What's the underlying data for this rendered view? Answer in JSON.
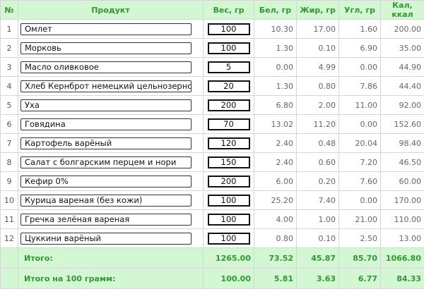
{
  "headers": {
    "num": "№",
    "product": "Продукт",
    "weight": "Вес, гр",
    "protein": "Бел, гр",
    "fat": "Жир, гр",
    "carb": "Угл, гр",
    "kcal": "Кал, ккал"
  },
  "rows": [
    {
      "n": "1",
      "product": "Омлет",
      "weight": "100",
      "protein": "10.30",
      "fat": "17.00",
      "carb": "1.60",
      "kcal": "200.00"
    },
    {
      "n": "2",
      "product": "Морковь",
      "weight": "100",
      "protein": "1.30",
      "fat": "0.10",
      "carb": "6.90",
      "kcal": "35.00"
    },
    {
      "n": "3",
      "product": "Масло оливковое",
      "weight": "5",
      "protein": "0.00",
      "fat": "4.99",
      "carb": "0.00",
      "kcal": "44.90"
    },
    {
      "n": "4",
      "product": "Хлеб Кернброт немецкий цельнозерновой",
      "weight": "20",
      "protein": "1.30",
      "fat": "0.80",
      "carb": "7.86",
      "kcal": "44.40"
    },
    {
      "n": "5",
      "product": "Уха",
      "weight": "200",
      "protein": "6.80",
      "fat": "2.00",
      "carb": "11.00",
      "kcal": "92.00"
    },
    {
      "n": "6",
      "product": "Говядина",
      "weight": "70",
      "protein": "13.02",
      "fat": "11.20",
      "carb": "0.00",
      "kcal": "152.60"
    },
    {
      "n": "7",
      "product": "Картофель варёный",
      "weight": "120",
      "protein": "2.40",
      "fat": "0.48",
      "carb": "20.04",
      "kcal": "98.40"
    },
    {
      "n": "8",
      "product": "Салат с болгарским перцем и нори",
      "weight": "150",
      "protein": "2.40",
      "fat": "0.60",
      "carb": "7.20",
      "kcal": "46.50"
    },
    {
      "n": "9",
      "product": "Кефир 0%",
      "weight": "200",
      "protein": "6.00",
      "fat": "0.20",
      "carb": "7.60",
      "kcal": "60.00"
    },
    {
      "n": "10",
      "product": "Курица вареная (без кожи)",
      "weight": "100",
      "protein": "25.20",
      "fat": "7.40",
      "carb": "0.00",
      "kcal": "170.00"
    },
    {
      "n": "11",
      "product": "Гречка зелёная вареная",
      "weight": "100",
      "protein": "4.00",
      "fat": "1.00",
      "carb": "21.00",
      "kcal": "110.00"
    },
    {
      "n": "12",
      "product": "Цуккини варёный",
      "weight": "100",
      "protein": "0.80",
      "fat": "0.10",
      "carb": "2.50",
      "kcal": "13.00"
    }
  ],
  "totals": {
    "label": "Итого:",
    "weight": "1265.00",
    "protein": "73.52",
    "fat": "45.87",
    "carb": "85.70",
    "kcal": "1066.80"
  },
  "per100": {
    "label": "Итого на 100 грамм:",
    "weight": "100.00",
    "protein": "5.81",
    "fat": "3.63",
    "carb": "6.77",
    "kcal": "84.33"
  },
  "colors": {
    "header_bg": "#d2f7d2",
    "header_text": "#2f9a2f"
  }
}
